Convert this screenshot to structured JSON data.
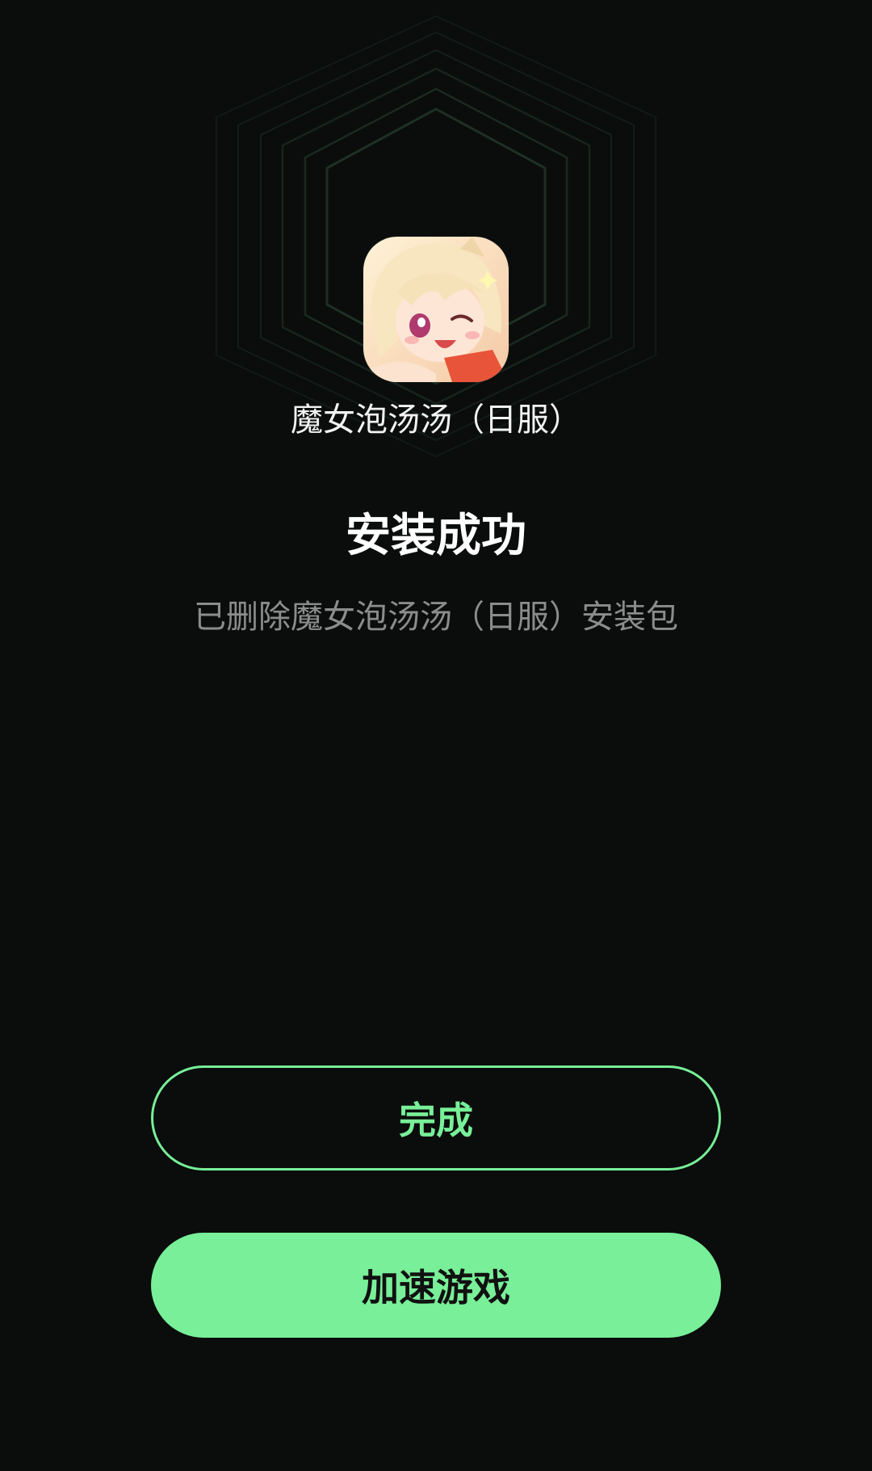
{
  "app": {
    "name": "魔女泡汤汤（日服）",
    "icon": "app-icon-anime-girl"
  },
  "status": {
    "title": "安装成功",
    "subtitle": "已删除魔女泡汤汤（日服）安装包"
  },
  "actions": {
    "done_label": "完成",
    "accelerate_label": "加速游戏"
  },
  "colors": {
    "background": "#0a0d0c",
    "accent": "#78ef98",
    "ring": "#1e2a22"
  }
}
